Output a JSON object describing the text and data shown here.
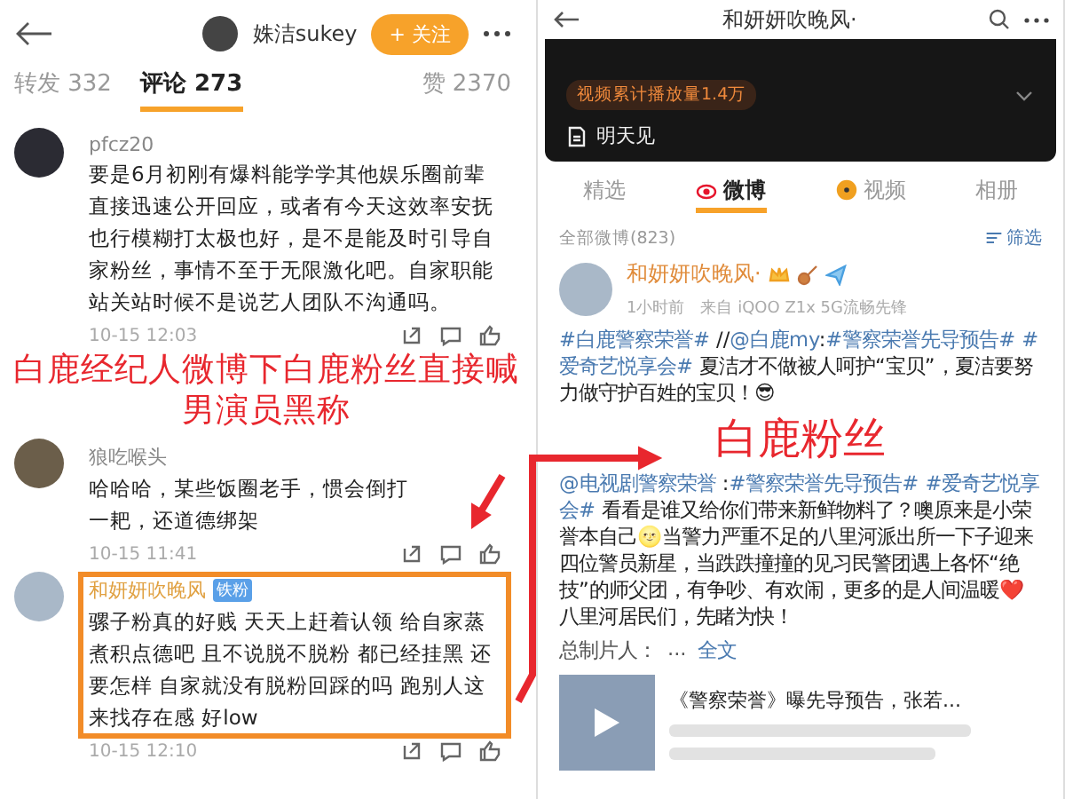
{
  "left": {
    "header": {
      "name": "姝洁sukey",
      "follow": "+ 关注"
    },
    "tabs": [
      {
        "label": "转发 332",
        "selected": false
      },
      {
        "label": "评论 273",
        "selected": true
      },
      {
        "label": "赞 2370",
        "selected": false
      }
    ],
    "comments": [
      {
        "user": "pfcz20",
        "text": "要是6月初刚有爆料能学学其他娱乐圈前辈直接迅速公开回应，或者有今天这效率安抚也行模糊打太极也好，是不是能及时引导自家粉丝，事情不至于无限激化吧。自家职能站关站时候不是说艺人团队不沟通吗。",
        "time": "10-15 12:03",
        "highlighted": false
      },
      {
        "user": "狼吃喉头",
        "text": "哈哈哈，某些饭圈老手，惯会倒打一耙，还道德绑架",
        "time": "10-15 11:41",
        "highlighted": false
      },
      {
        "user": "和妍妍吹晚风",
        "fan_badge": "铁粉",
        "text": "骡子粉真的好贱 天天上赶着认领 给自家蒸煮积点德吧 且不说脱不脱粉 都已经挂黑 还要怎样 自家就没有脱粉回踩的吗 跑别人这来找存在感 好low",
        "time": "10-15 12:10",
        "highlighted": true
      }
    ]
  },
  "right": {
    "header": {
      "title": "和妍妍吹晚风·"
    },
    "profile": {
      "badge": "视频累计播放量1.4万",
      "bio": "明天见"
    },
    "tabs": [
      {
        "label": "精选",
        "selected": false
      },
      {
        "label": "微博",
        "selected": true
      },
      {
        "label": "视频",
        "selected": false
      },
      {
        "label": "相册",
        "selected": false
      }
    ],
    "count": "全部微博(823)",
    "filter": "筛选",
    "post": {
      "user": "和妍妍吹晚风·",
      "time": "1小时前",
      "source": "来自 iQOO Z1x 5G流畅先锋",
      "paragraphs": [
        [
          {
            "text": "#白鹿警察荣誉#",
            "link": true
          },
          {
            "text": " //",
            "link": false
          },
          {
            "text": "@白鹿my",
            "link": true
          },
          {
            "text": ":",
            "link": false
          },
          {
            "text": "#警察荣誉先导预告#",
            "link": true
          },
          {
            "text": " #爱奇艺悦享会#",
            "link": true
          },
          {
            "text": " 夏洁才不做被人呵护“宝贝”，夏洁要努力做守护百姓的宝贝！😎",
            "link": false
          }
        ],
        [
          {
            "text": "@电视剧警察荣誉",
            "link": true
          },
          {
            "text": " :",
            "link": false
          },
          {
            "text": "#警察荣誉先导预告#",
            "link": true
          },
          {
            "text": " #爱奇艺悦享会#",
            "link": true
          },
          {
            "text": " 看看是谁又给你们带来新鲜物料了？噢原来是小荣誉本自己🌝当警力严重不足的八里河派出所一下子迎来四位警员新星，当跌跌撞撞的见习民警团遇上各怀“绝技”的师父团，有争吵、有欢闹，更多的是人间温暖❤️八里河居民们，先睹为快！",
            "link": false
          }
        ]
      ],
      "credits": "总制片人：",
      "more_dots": "...",
      "more": "全文",
      "video": {
        "title": "《警察荣誉》曝先导预告，张若..."
      }
    }
  },
  "annotations": {
    "caption": [
      "白鹿经纪人微博下白鹿粉丝直接喊",
      "男演员黑称"
    ],
    "label": "白鹿粉丝"
  }
}
